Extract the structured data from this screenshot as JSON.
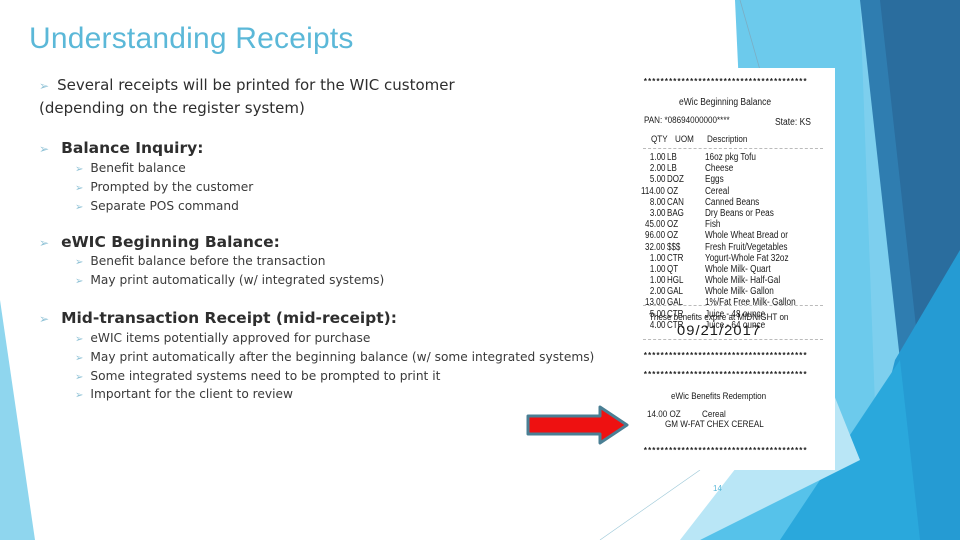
{
  "slide": {
    "title": "Understanding Receipts",
    "page_number": "14",
    "bullet_icon": "arrow-bullet-icon",
    "colors": {
      "title": "#5bb8d8",
      "bullet": "#8fc2d6",
      "arrow_fill": "#ee1111",
      "arrow_outline": "#4a7f94"
    }
  },
  "intro": {
    "line1": "Several receipts will be printed for the WIC customer",
    "line2": "(depending on the register system)"
  },
  "sections": [
    {
      "heading": "Balance Inquiry:",
      "items": [
        "Benefit balance",
        "Prompted by the customer",
        "Separate POS command"
      ]
    },
    {
      "heading": "eWIC Beginning Balance:",
      "items": [
        "Benefit balance before the transaction",
        "May print automatically (w/ integrated systems)"
      ]
    },
    {
      "heading": "Mid-transaction Receipt (mid-receipt):",
      "items": [
        "eWIC items potentially approved for purchase",
        "May print automatically after the beginning balance (w/ some integrated systems)",
        "Some integrated systems need to be prompted to print it",
        "Important for the client to review"
      ]
    }
  ],
  "receipt": {
    "stars": "***************************************",
    "header": "eWic Beginning Balance",
    "pan": "PAN: *08694000000****",
    "state": "State: KS",
    "col_qty": "QTY",
    "col_uom": "UOM",
    "col_desc": "Description",
    "items": [
      {
        "qty": "1.00",
        "uom": "LB",
        "desc": "16oz pkg Tofu"
      },
      {
        "qty": "2.00",
        "uom": "LB",
        "desc": "Cheese"
      },
      {
        "qty": "5.00",
        "uom": "DOZ",
        "desc": "Eggs"
      },
      {
        "qty": "114.00",
        "uom": "OZ",
        "desc": "Cereal"
      },
      {
        "qty": "8.00",
        "uom": "CAN",
        "desc": "Canned Beans"
      },
      {
        "qty": "3.00",
        "uom": "BAG",
        "desc": "Dry Beans or Peas"
      },
      {
        "qty": "45.00",
        "uom": "OZ",
        "desc": "Fish"
      },
      {
        "qty": "96.00",
        "uom": "OZ",
        "desc": "Whole Wheat Bread or"
      },
      {
        "qty": "32.00",
        "uom": "$$$",
        "desc": "Fresh Fruit/Vegetables"
      },
      {
        "qty": "1.00",
        "uom": "CTR",
        "desc": "Yogurt-Whole Fat 32oz"
      },
      {
        "qty": "1.00",
        "uom": "QT",
        "desc": "Whole Milk- Quart"
      },
      {
        "qty": "1.00",
        "uom": "HGL",
        "desc": "Whole Milk- Half-Gal"
      },
      {
        "qty": "2.00",
        "uom": "GAL",
        "desc": "Whole Milk- Gallon"
      },
      {
        "qty": "13.00",
        "uom": "GAL",
        "desc": "1%/Fat Free Milk- Gallon"
      },
      {
        "qty": "5.00",
        "uom": "CTR",
        "desc": "Juice - 48 ounce"
      },
      {
        "qty": "4.00",
        "uom": "CTR",
        "desc": "Juice - 64 ounce"
      }
    ],
    "expire_text": "These benefits expire at MIDNIGHT on",
    "expire_date": "09/21/2017",
    "redemption_header": "eWic Benefits Redemption",
    "redemption_line1_qty": "14.00 OZ",
    "redemption_line1_desc": "Cereal",
    "redemption_line2": "GM W-FAT CHEX CEREAL"
  }
}
